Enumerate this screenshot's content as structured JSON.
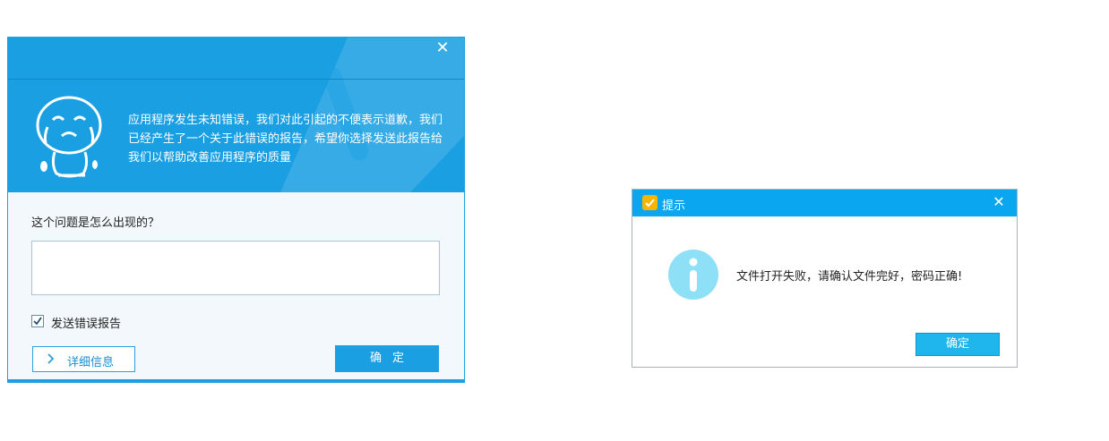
{
  "crash_dialog": {
    "close_glyph": "✕",
    "message": "应用程序发生未知错误，我们对此引起的不便表示道歉，我们已经产生了一个关于此错误的报告，希望你选择发送此报告给我们以帮助改善应用程序的质量",
    "question_label": "这个问题是怎么出现的？",
    "problem_input_value": "",
    "send_report": {
      "label": "发送错误报告",
      "checked": true
    },
    "details_button_label": "详细信息",
    "ok_button_label": "确定",
    "icons": [
      "close-icon",
      "crying-mascot-icon",
      "warning-watermark-icon",
      "checkmark-icon",
      "chevron-right-icon"
    ],
    "colors": {
      "header": "#1a9fe2",
      "body": "#f2f8fb",
      "accent": "#2d9fd9"
    }
  },
  "alert_dialog": {
    "title": "提示",
    "close_glyph": "✕",
    "message": "文件打开失败，请确认文件完好，密码正确!",
    "ok_button_label": "确定",
    "icons": [
      "app-icon",
      "close-icon",
      "info-icon"
    ],
    "colors": {
      "titlebar": "#0aa7f0",
      "info_icon": "#8ee0f6",
      "button": "#1fb6ee"
    }
  }
}
